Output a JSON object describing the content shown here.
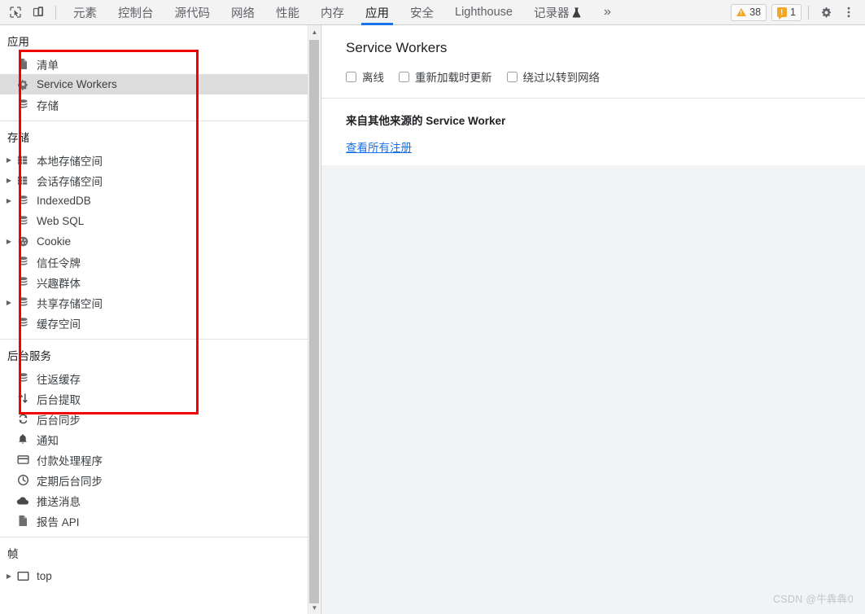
{
  "toolbar": {
    "inspect_icon": "inspect-cursor-icon",
    "device_icon": "device-toolbar-icon",
    "tabs": [
      {
        "label": "元素",
        "active": false
      },
      {
        "label": "控制台",
        "active": false
      },
      {
        "label": "源代码",
        "active": false
      },
      {
        "label": "网络",
        "active": false
      },
      {
        "label": "性能",
        "active": false
      },
      {
        "label": "内存",
        "active": false
      },
      {
        "label": "应用",
        "active": true
      },
      {
        "label": "安全",
        "active": false
      },
      {
        "label": "Lighthouse",
        "active": false
      },
      {
        "label": "记录器",
        "active": false,
        "flask": "⚗"
      }
    ],
    "more_tabs": "»",
    "warnings_count": "38",
    "issues_count": "1",
    "settings_icon": "gear-icon",
    "kebab_icon": "more-options-icon"
  },
  "sidebar": {
    "sections": [
      {
        "title": "应用",
        "items": [
          {
            "label": "清单",
            "icon": "document-icon",
            "arrow": false,
            "selected": false
          },
          {
            "label": "Service Workers",
            "icon": "gear-icon",
            "arrow": false,
            "selected": true
          },
          {
            "label": "存储",
            "icon": "database-icon",
            "arrow": false,
            "selected": false
          }
        ]
      },
      {
        "title": "存储",
        "items": [
          {
            "label": "本地存储空间",
            "icon": "table-icon",
            "arrow": true,
            "selected": false
          },
          {
            "label": "会话存储空间",
            "icon": "table-icon",
            "arrow": true,
            "selected": false
          },
          {
            "label": "IndexedDB",
            "icon": "database-icon",
            "arrow": true,
            "selected": false
          },
          {
            "label": "Web SQL",
            "icon": "database-icon",
            "arrow": false,
            "selected": false
          },
          {
            "label": "Cookie",
            "icon": "cookie-icon",
            "arrow": true,
            "selected": false
          },
          {
            "label": "信任令牌",
            "icon": "database-icon",
            "arrow": false,
            "selected": false
          },
          {
            "label": "兴趣群体",
            "icon": "database-icon",
            "arrow": false,
            "selected": false
          },
          {
            "label": "共享存储空间",
            "icon": "database-icon",
            "arrow": true,
            "selected": false
          },
          {
            "label": "缓存空间",
            "icon": "database-icon",
            "arrow": false,
            "selected": false
          }
        ]
      },
      {
        "title": "后台服务",
        "items": [
          {
            "label": "往返缓存",
            "icon": "database-icon",
            "arrow": false,
            "selected": false
          },
          {
            "label": "后台提取",
            "icon": "updown-arrows-icon",
            "arrow": false,
            "selected": false
          },
          {
            "label": "后台同步",
            "icon": "sync-icon",
            "arrow": false,
            "selected": false
          },
          {
            "label": "通知",
            "icon": "bell-icon",
            "arrow": false,
            "selected": false
          },
          {
            "label": "付款处理程序",
            "icon": "credit-card-icon",
            "arrow": false,
            "selected": false
          },
          {
            "label": "定期后台同步",
            "icon": "clock-icon",
            "arrow": false,
            "selected": false
          },
          {
            "label": "推送消息",
            "icon": "cloud-icon",
            "arrow": false,
            "selected": false
          },
          {
            "label": "报告 API",
            "icon": "document-icon",
            "arrow": false,
            "selected": false
          }
        ]
      },
      {
        "title": "帧",
        "items": [
          {
            "label": "top",
            "icon": "frame-icon",
            "arrow": true,
            "selected": false
          }
        ]
      }
    ]
  },
  "main": {
    "title": "Service Workers",
    "checkboxes": [
      {
        "label": "离线",
        "checked": false
      },
      {
        "label": "重新加载时更新",
        "checked": false
      },
      {
        "label": "绕过以转到网络",
        "checked": false
      }
    ],
    "other_origins_heading": "来自其他来源的 Service Worker",
    "see_all_link": "查看所有注册"
  },
  "annotation": {
    "color": "#f40000",
    "shape": "rectangle"
  },
  "watermark": "CSDN @牛犇犇0"
}
